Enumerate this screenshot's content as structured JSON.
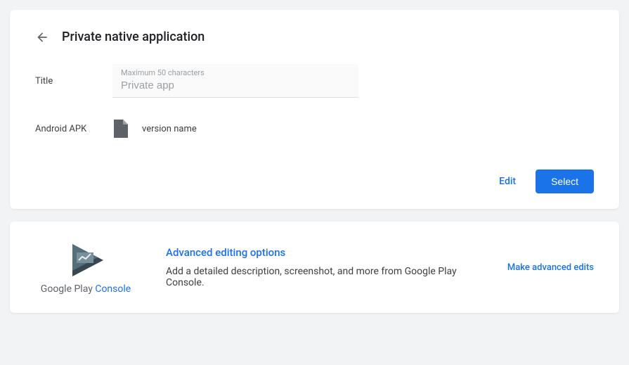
{
  "header": {
    "title": "Private native application"
  },
  "form": {
    "titleLabel": "Title",
    "titleHint": "Maximum 50 characters",
    "titleValue": "Private app",
    "apkLabel": "Android APK",
    "versionName": "version name"
  },
  "buttons": {
    "edit": "Edit",
    "select": "Select"
  },
  "advanced": {
    "logoText1": "Google Play",
    "logoText2": "Console",
    "title": "Advanced editing options",
    "description": "Add a detailed description, screenshot, and more from Google Play Console.",
    "link": "Make advanced edits"
  }
}
